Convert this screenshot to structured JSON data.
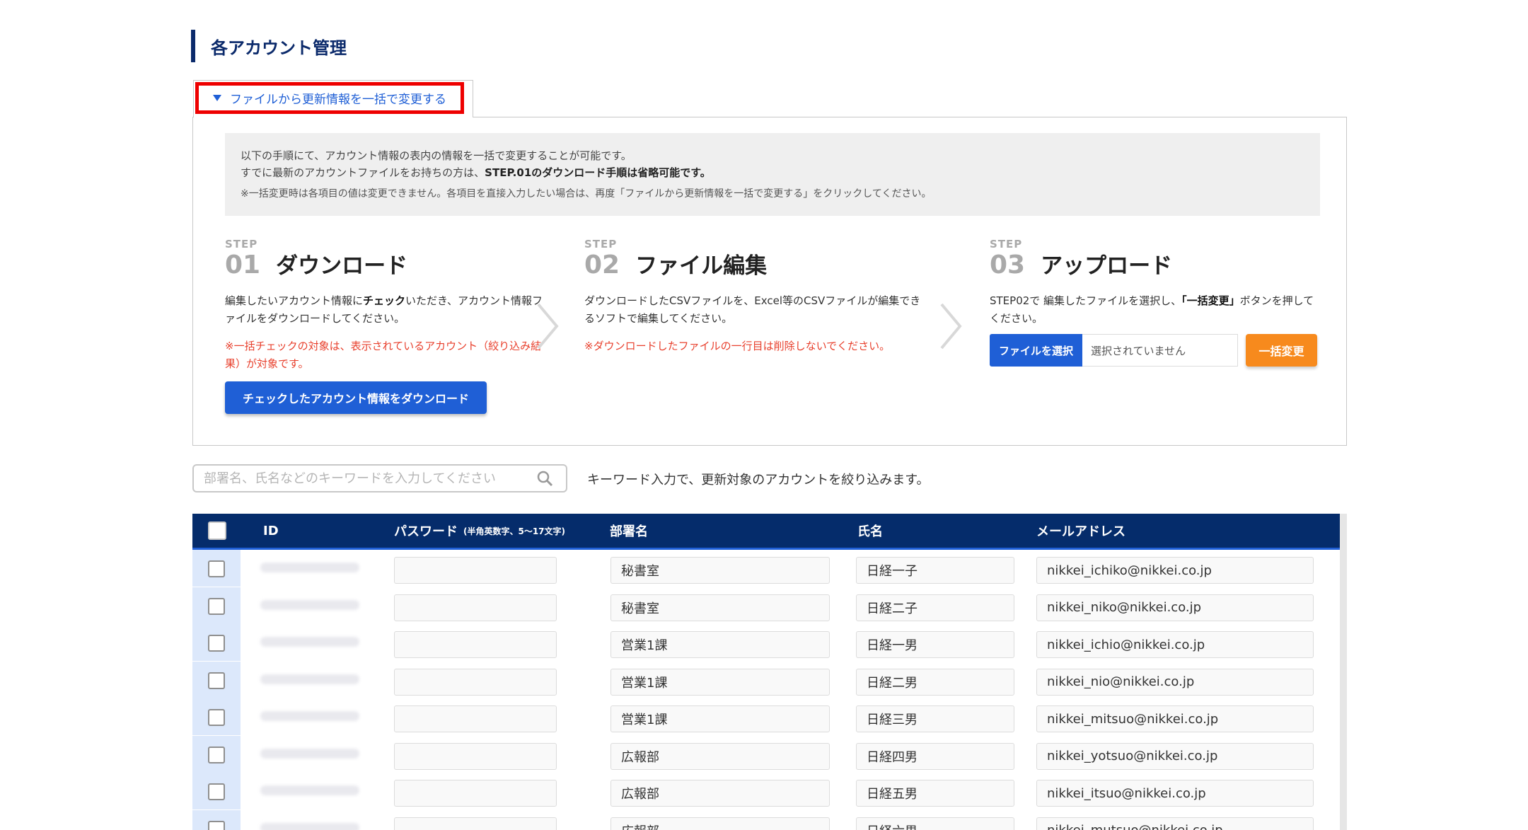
{
  "page": {
    "title": "各アカウント管理"
  },
  "toggle": {
    "label": "ファイルから更新情報を一括で変更する"
  },
  "notice": {
    "line1": "以下の手順にて、アカウント情報の表内の情報を一括で変更することが可能です。",
    "line2_prefix": "すでに最新のアカウントファイルをお持ちの方は、",
    "line2_bold": "STEP.01のダウンロード手順は省略可能です。",
    "line3": "※一括変更時は各項目の値は変更できません。各項目を直接入力したい場合は、再度「ファイルから更新情報を一括で変更する」をクリックしてください。"
  },
  "steps": [
    {
      "label": "STEP",
      "num": "01",
      "title": "ダウンロード",
      "desc_prefix": "編集したいアカウント情報に",
      "desc_bold": "チェック",
      "desc_suffix": "いただき、アカウント情報ファイルをダウンロードしてください。",
      "warn": "※一括チェックの対象は、表示されているアカウント（絞り込み結果）が対象です。",
      "button": "チェックしたアカウント情報をダウンロード"
    },
    {
      "label": "STEP",
      "num": "02",
      "title": "ファイル編集",
      "desc": "ダウンロードしたCSVファイルを、Excel等のCSVファイルが編集できるソフトで編集してください。",
      "warn": "※ダウンロードしたファイルの一行目は削除しないでください。"
    },
    {
      "label": "STEP",
      "num": "03",
      "title": "アップロード",
      "desc_prefix": "STEP02で 編集したファイルを選択し、",
      "desc_bold": "「一括変更」",
      "desc_suffix": "ボタンを押してください。",
      "file_button": "ファイルを選択",
      "file_status": "選択されていません",
      "bulk_button": "一括変更"
    }
  ],
  "search": {
    "placeholder": "部署名、氏名などのキーワードを入力してください",
    "hint": "キーワード入力で、更新対象のアカウントを絞り込みます。",
    "icon": "search-icon"
  },
  "table": {
    "headers": {
      "id": "ID",
      "password": "パスワード",
      "password_note": "(半角英数字、5～17文字)",
      "dept": "部署名",
      "name": "氏名",
      "email": "メールアドレス"
    },
    "rows": [
      {
        "dept": "秘書室",
        "name": "日経一子",
        "email": "nikkei_ichiko@nikkei.co.jp"
      },
      {
        "dept": "秘書室",
        "name": "日経二子",
        "email": "nikkei_niko@nikkei.co.jp"
      },
      {
        "dept": "営業1課",
        "name": "日経一男",
        "email": "nikkei_ichio@nikkei.co.jp"
      },
      {
        "dept": "営業1課",
        "name": "日経二男",
        "email": "nikkei_nio@nikkei.co.jp"
      },
      {
        "dept": "営業1課",
        "name": "日経三男",
        "email": "nikkei_mitsuo@nikkei.co.jp"
      },
      {
        "dept": "広報部",
        "name": "日経四男",
        "email": "nikkei_yotsuo@nikkei.co.jp"
      },
      {
        "dept": "広報部",
        "name": "日経五男",
        "email": "nikkei_itsuo@nikkei.co.jp"
      },
      {
        "dept": "広報部",
        "name": "日経六男",
        "email": "nikkei_mutsuo@nikkei.co.jp"
      }
    ]
  },
  "colors": {
    "navy": "#052c6b",
    "primary_blue": "#1f5fd6",
    "orange": "#f78a1d",
    "warning_red": "#e8402d",
    "highlight_red": "#ee0000"
  }
}
